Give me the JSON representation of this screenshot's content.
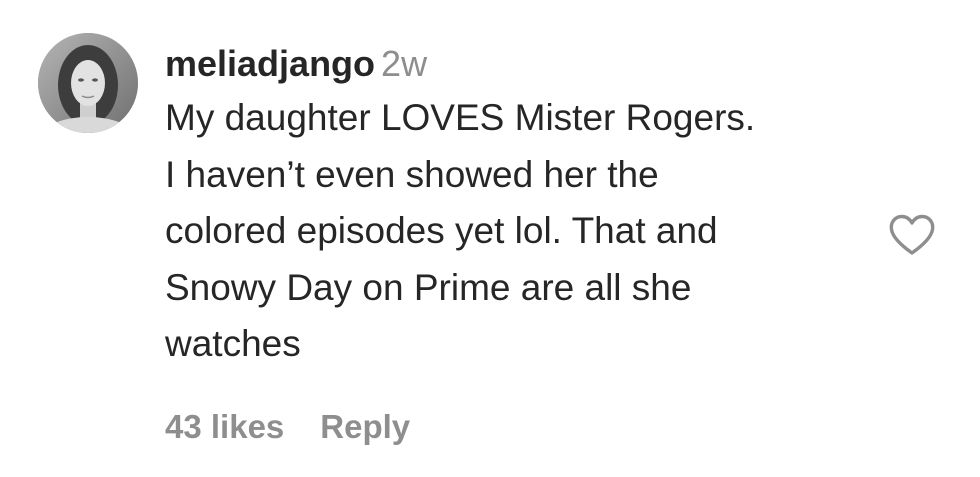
{
  "comment": {
    "username": "meliadjango",
    "timestamp": "2w",
    "text_lines": [
      "My daughter LOVES Mister Rogers.",
      "I haven’t even showed her the",
      "colored episodes yet lol. That and",
      "Snowy Day on Prime are all she",
      "watches"
    ],
    "likes_label": "43 likes",
    "reply_label": "Reply",
    "like_icon": "heart-outline-icon",
    "avatar_icon": "profile-photo"
  }
}
